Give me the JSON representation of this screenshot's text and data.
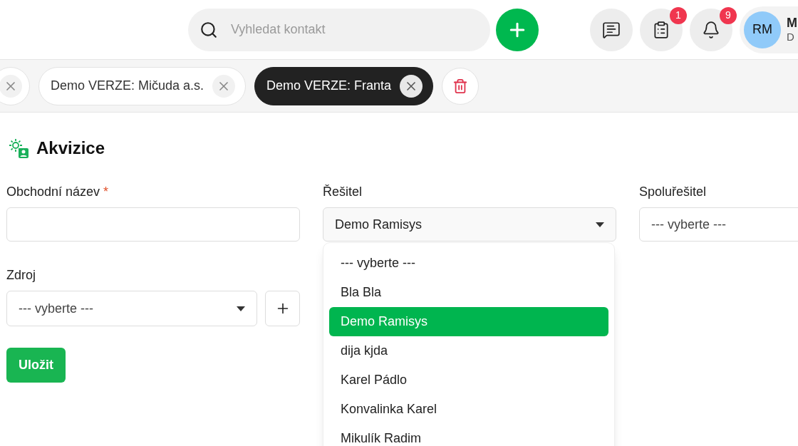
{
  "header": {
    "search": {
      "placeholder": "Vyhledat kontakt"
    },
    "icon_buttons": [
      {
        "kind": "messages"
      },
      {
        "kind": "clipboard",
        "badge": "1"
      },
      {
        "kind": "bell",
        "badge": "9"
      }
    ],
    "user": {
      "initials": "RM",
      "name": "M",
      "subtitle": "D"
    }
  },
  "tabs": [
    {
      "selected": false
    },
    {
      "label": "Demo VERZE: Mičuda a.s.",
      "selected": false
    },
    {
      "label": "Demo VERZE: Franta",
      "selected": true
    }
  ],
  "page": {
    "title": "Akvizice"
  },
  "form": {
    "name_field": {
      "label": "Obchodní název",
      "required_mark": "*"
    },
    "resitel": {
      "label": "Řešitel",
      "value": "Demo Ramisys"
    },
    "spoluresitel": {
      "label": "Spoluřešitel",
      "value": "--- vyberte ---"
    },
    "zdroj": {
      "label": "Zdroj",
      "value": "--- vyberte ---"
    },
    "save": "Uložit"
  },
  "dropdown": {
    "options": [
      {
        "label": "--- vyberte ---",
        "selected": false
      },
      {
        "label": "Bla Bla",
        "selected": false
      },
      {
        "label": "Demo Ramisys",
        "selected": true
      },
      {
        "label": "dija kjda",
        "selected": false
      },
      {
        "label": "Karel Pádlo",
        "selected": false
      },
      {
        "label": "Konvalinka Karel",
        "selected": false
      },
      {
        "label": "Mikulík Radim",
        "selected": false
      }
    ]
  }
}
